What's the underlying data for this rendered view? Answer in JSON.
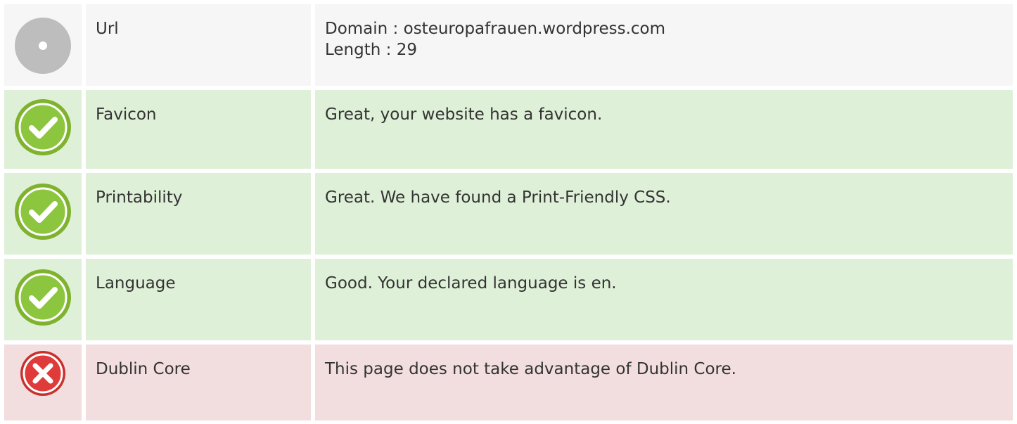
{
  "rows": [
    {
      "status": "neutral",
      "icon": "info-dot-icon",
      "label": "Url",
      "lines": [
        "Domain : osteuropafrauen.wordpress.com",
        "Length : 29"
      ]
    },
    {
      "status": "pass",
      "icon": "check-icon",
      "label": "Favicon",
      "lines": [
        "Great, your website has a favicon."
      ]
    },
    {
      "status": "pass",
      "icon": "check-icon",
      "label": "Printability",
      "lines": [
        "Great. We have found a Print-Friendly CSS."
      ]
    },
    {
      "status": "pass",
      "icon": "check-icon",
      "label": "Language",
      "lines": [
        "Good. Your declared language is en."
      ]
    },
    {
      "status": "fail",
      "icon": "cross-icon",
      "label": "Dublin Core",
      "lines": [
        "This page does not take advantage of Dublin Core."
      ]
    }
  ],
  "colors": {
    "neutral_bg": "#f6f6f6",
    "pass_bg": "#dff0d8",
    "fail_bg": "#f2dede",
    "pass_icon": "#8cc63f",
    "fail_icon": "#e03030",
    "neutral_icon": "#bdbdbd"
  }
}
